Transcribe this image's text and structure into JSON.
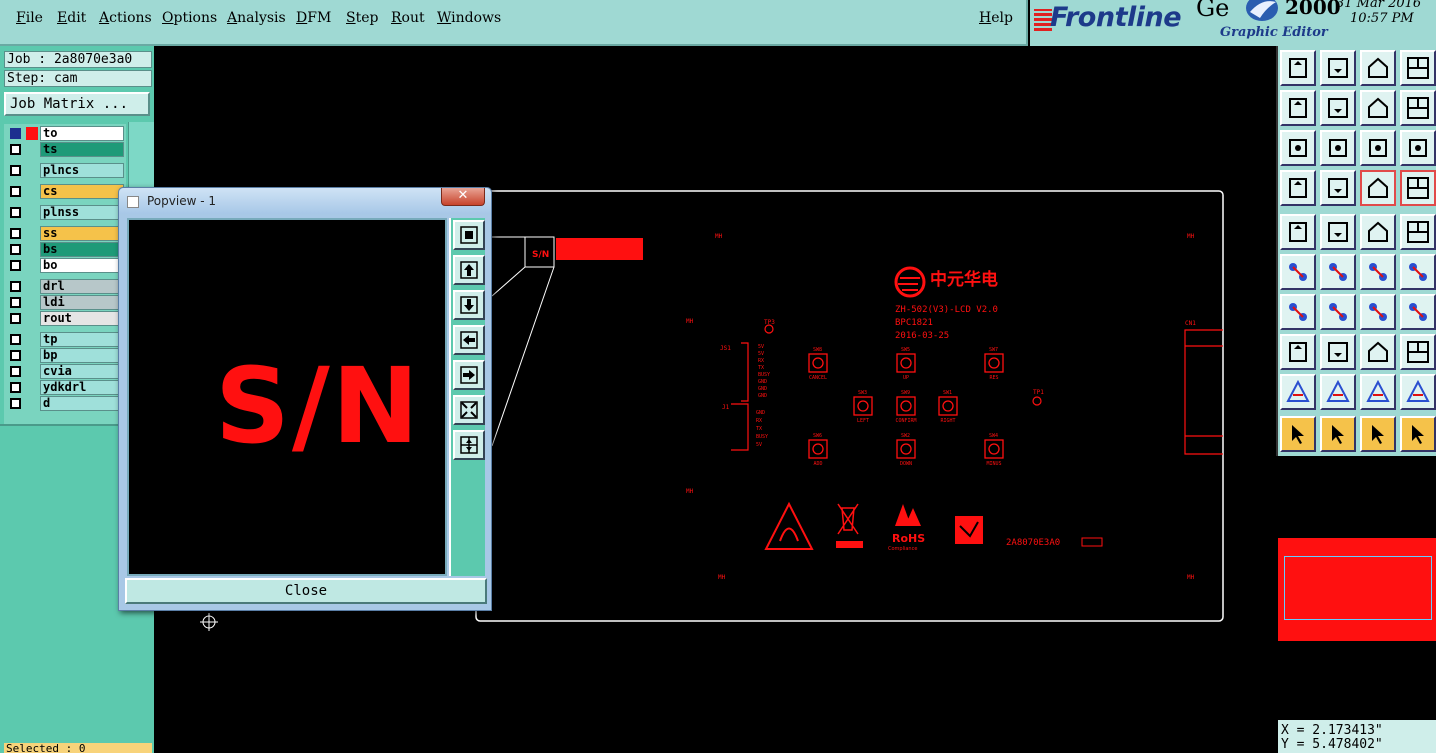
{
  "menubar": {
    "items": [
      "File",
      "Edit",
      "Actions",
      "Options",
      "Analysis",
      "DFM",
      "Step",
      "Rout",
      "Windows"
    ],
    "help": "Help"
  },
  "logo": {
    "brand": "Frontline",
    "product": "Ge",
    "year": "2000",
    "subtitle": "Graphic Editor",
    "date": "31 Mar 2016",
    "time": "10:57 PM"
  },
  "left": {
    "job": "Job : 2a8070e3a0",
    "step": "Step: cam",
    "job_matrix": "Job Matrix ...",
    "selected": "Selected : 0",
    "layers": [
      {
        "name": "to",
        "color": "#ffffff",
        "active": true
      },
      {
        "name": "ts",
        "color": "#1e9a78"
      },
      {
        "name": "plncs",
        "color": "#9fe0da"
      },
      {
        "name": "cs",
        "color": "#f5c24a"
      },
      {
        "name": "plnss",
        "color": "#9fe0da"
      },
      {
        "name": "ss",
        "color": "#f5c24a"
      },
      {
        "name": "bs",
        "color": "#1e9a78"
      },
      {
        "name": "bo",
        "color": "#ffffff"
      },
      {
        "name": "drl",
        "color": "#b7c7c9"
      },
      {
        "name": "ldi",
        "color": "#b7c7c9"
      },
      {
        "name": "rout",
        "color": "#e5e5e5"
      },
      {
        "name": "tp",
        "color": "#9fe0da"
      },
      {
        "name": "bp",
        "color": "#9fe0da"
      },
      {
        "name": "cvia",
        "color": "#9fe0da"
      },
      {
        "name": "ydkdrl",
        "color": "#9fe0da"
      },
      {
        "name": "d",
        "color": "#9fe0da"
      }
    ]
  },
  "popview": {
    "title": "Popview - 1",
    "close_x": "✕",
    "zoom_text": "S/N",
    "close_button": "Close"
  },
  "board": {
    "title": "ZH-502(V3)-LCD V2.0",
    "part": "BPC1821",
    "date": "2016-03-25",
    "brand_cn": "中元华电",
    "job_code": "2A8070E3A0",
    "sn_label": "S/N",
    "rohs": "RoHS",
    "rohs_sub": "Compliance",
    "buttons": [
      "CANCEL",
      "UP",
      "RES",
      "LEFT",
      "CONFIRM",
      "RIGHT",
      "ADD",
      "DOWN",
      "MINUS"
    ],
    "button_refs": [
      "SW8",
      "SW5",
      "SW7",
      "SW3",
      "SW9",
      "SW1",
      "SW6",
      "SW2",
      "SW4"
    ],
    "header_pins": [
      "5V",
      "5V",
      "RX",
      "TX",
      "BUSY",
      "GND",
      "GND",
      "GND"
    ],
    "header2_pins": [
      "GND",
      "RX",
      "TX",
      "BUSY",
      "5V"
    ],
    "mount_holes": "MH",
    "tp3": "TP3",
    "tp1": "TP1",
    "j1": "J1",
    "cn1": "CN1"
  },
  "coords": {
    "x": "X = 2.173413\"",
    "y": "Y = 5.478402\""
  },
  "colors": {
    "panel": "#9fd9d3",
    "layer_panel": "#5cc9ae",
    "feature": "#ff1010",
    "outline": "#ffffff"
  }
}
